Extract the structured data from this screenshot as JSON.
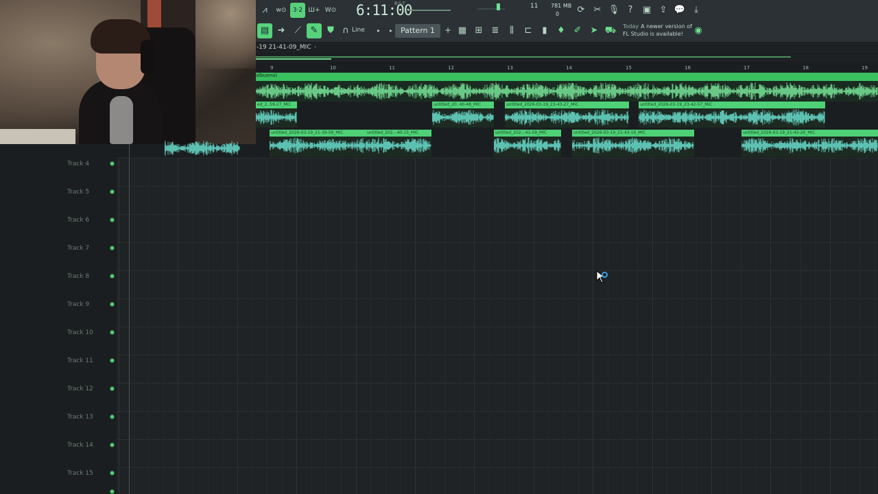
{
  "toolbar": {
    "time_display": "6:11:00",
    "time_unit": "B:S:T",
    "cpu_value": "11",
    "memory_value": "781 MB",
    "polyphony_value": "0",
    "snap_label": "Line",
    "pattern_label": "Pattern 1",
    "pattern_add": "+",
    "news_when": "Today",
    "news_text": "A newer version of FL Studio is available!",
    "icons_row1": [
      "master-pitch-icon",
      "wait-record-icon",
      "countdown-icon",
      "step-record-icon",
      "blend-record-icon"
    ],
    "icons_row1_right": [
      "undo-history-icon",
      "audio-settings-icon",
      "mic-icon",
      "help-icon",
      "save-icon",
      "export-icon",
      "chat-icon",
      "download-icon"
    ],
    "icons_row2": [
      "playlist-icon",
      "arrow-icon",
      "paint-icon",
      "pencil-icon",
      "stamp-icon",
      "magnet-icon"
    ],
    "icons_row2_right": [
      "playlist-view-icon",
      "piano-roll-icon",
      "channel-rack-icon",
      "mixer-icon",
      "browser-icon",
      "plugin-icon",
      "touch-icon",
      "brush-icon",
      "arrow-right-icon",
      "shop-icon",
      "globe-icon"
    ]
  },
  "breadcrumb": {
    "text": "-19 21-41-09_MIC",
    "arrow": "›"
  },
  "ruler": {
    "bars": [
      "9",
      "10",
      "11",
      "12",
      "13",
      "14",
      "15",
      "16",
      "17",
      "18",
      "19"
    ]
  },
  "audio_track": {
    "header": "albuena)",
    "clips_row2": [
      "ed_2..59-27_MIC",
      "untitled_20..40-48_MIC",
      "untitled_2026-03-19_23-43-27_MIC",
      "untitled_2026-03-19_23-42-57_MIC"
    ],
    "clips_row3": [
      "untitled_2026-03-19_21-39-58_MIC",
      "untitled_202..-40-15_MIC",
      "untitled_202..-41-09_MIC",
      "untitled_2026-03-19_21-43-16_MIC",
      "untitled_2026-03-19_21-43-26_MIC"
    ]
  },
  "tracks": [
    "Track 4",
    "Track 5",
    "Track 6",
    "Track 7",
    "Track 8",
    "Track 9",
    "Track 10",
    "Track 11",
    "Track 12",
    "Track 13",
    "Track 14",
    "Track 15"
  ],
  "colors": {
    "accent": "#58d27a",
    "clip_head": "#4fd277",
    "wave": "#7ff0a0",
    "cyan_wave": "#6fe8d8",
    "background": "#1f2326"
  }
}
